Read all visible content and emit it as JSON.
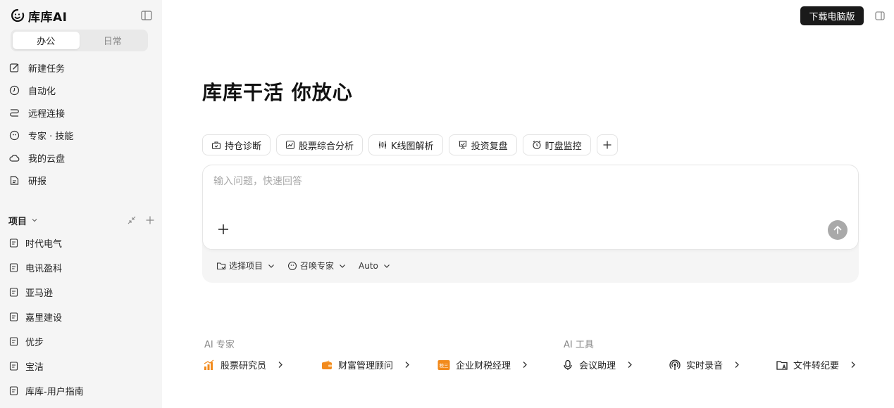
{
  "brand": {
    "name": "库库AI",
    "logo_icon": "smile-face-icon"
  },
  "sidebar": {
    "tabs": [
      {
        "label": "办公",
        "active": true
      },
      {
        "label": "日常",
        "active": false
      }
    ],
    "nav": [
      {
        "label": "新建任务",
        "icon": "edit-icon"
      },
      {
        "label": "自动化",
        "icon": "clock-icon"
      },
      {
        "label": "远程连接",
        "icon": "route-icon"
      },
      {
        "label": "专家 · 技能",
        "icon": "expert-icon"
      },
      {
        "label": "我的云盘",
        "icon": "cloud-icon"
      },
      {
        "label": "研报",
        "icon": "report-icon"
      }
    ],
    "projects_title": "项目",
    "projects": [
      "时代电气",
      "电讯盈科",
      "亚马逊",
      "嘉里建设",
      "优步",
      "宝洁",
      "库库-用户指南"
    ]
  },
  "header": {
    "download_label": "下载电脑版"
  },
  "main": {
    "title": "库库干活 你放心",
    "chips": [
      {
        "label": "持仓诊断",
        "icon": "briefcase-icon"
      },
      {
        "label": "股票综合分析",
        "icon": "chart-icon"
      },
      {
        "label": "K线图解析",
        "icon": "candlestick-icon"
      },
      {
        "label": "投资复盘",
        "icon": "presentation-icon"
      },
      {
        "label": "盯盘监控",
        "icon": "alarm-icon"
      }
    ],
    "composer": {
      "placeholder": "输入问题，快速回答",
      "select_project": "选择项目",
      "summon_expert": "召唤专家",
      "model": "Auto"
    },
    "experts_title": "AI 专家",
    "experts": [
      {
        "label": "股票研究员",
        "icon": "bar-chart-icon"
      },
      {
        "label": "财富管理顾问",
        "icon": "wallet-icon"
      },
      {
        "label": "企业财税经理",
        "icon": "tax-icon",
        "badge": "税三"
      }
    ],
    "tools_title": "AI 工具",
    "tools": [
      {
        "label": "会议助理",
        "icon": "microphone-icon"
      },
      {
        "label": "实时录音",
        "icon": "broadcast-icon"
      },
      {
        "label": "文件转纪要",
        "icon": "folder-text-icon"
      }
    ]
  },
  "colors": {
    "accent_orange": "#f28a1c",
    "dark": "#1a1a1a",
    "sidebar_bg": "#f5f5f5"
  }
}
